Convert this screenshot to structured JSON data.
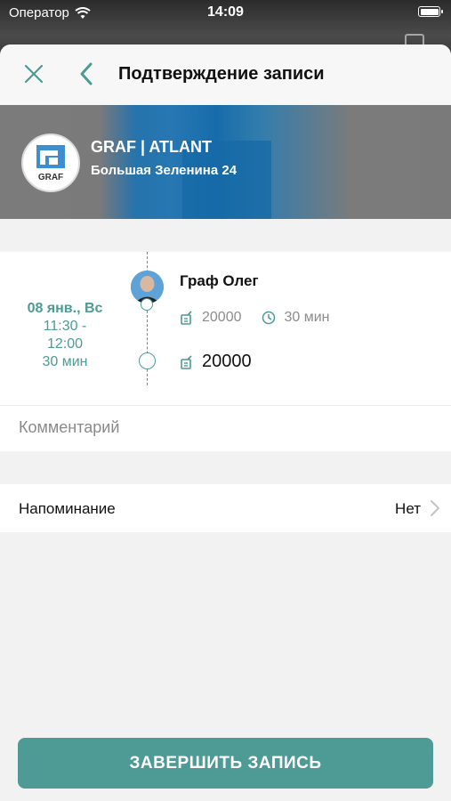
{
  "status_bar": {
    "carrier": "Оператор",
    "time": "14:09"
  },
  "nav": {
    "title": "Подтверждение записи"
  },
  "salon": {
    "name": "GRAF | ATLANT",
    "address": "Большая Зеленина 24",
    "logo_text": "GRAF"
  },
  "booking": {
    "date": "08 янв., Вс",
    "time_from": "11:30 -",
    "time_to": "12:00",
    "duration": "30 мин",
    "master": "Граф Олег",
    "service_price": "20000",
    "service_duration": "30 мин",
    "total": "20000"
  },
  "comment": {
    "placeholder": "Комментарий"
  },
  "reminder": {
    "label": "Напоминание",
    "value": "Нет"
  },
  "actions": {
    "finish_label": "ЗАВЕРШИТЬ ЗАПИСЬ"
  },
  "colors": {
    "accent": "#4e9a94",
    "sheet_bg": "#f2f2f2"
  }
}
